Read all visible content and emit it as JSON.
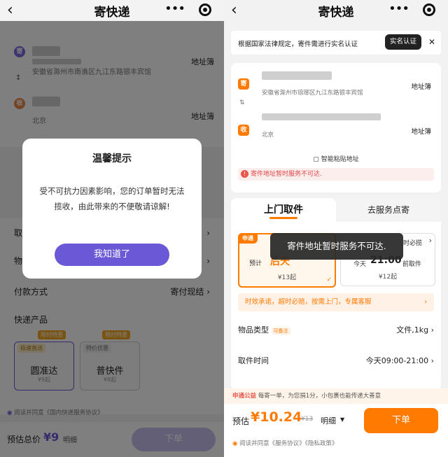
{
  "left": {
    "title": "寄快递",
    "sender_address": "安徽省滁州市南谯区九江东路银丰宾馆",
    "address_book_label": "地址簿",
    "receiver_city": "北京",
    "receiver_address_book_label": "地址簿",
    "payment_label": "付款方式",
    "payment_value": "寄付现结",
    "products_label": "快递产品",
    "products": [
      {
        "tag": "极速直送",
        "badge": "限时特惠",
        "name": "圆准达",
        "price": "¥9起"
      },
      {
        "tag": "特价优惠",
        "badge": "限时特惠",
        "name": "普快件",
        "price": "¥8起"
      }
    ],
    "agreement": "阅读并同意《国内快递服务协议》",
    "estimate_label": "预估总价",
    "estimate_value": "¥9",
    "detail_label": "明细",
    "submit_label": "下单",
    "dialog": {
      "title": "温馨提示",
      "message": "受不可抗力因素影响，您的订单暂时无法揽收，由此带来的不便敬请谅解!",
      "button": "我知道了"
    }
  },
  "right": {
    "title": "寄快递",
    "notice_text": "根据国家法律规定，寄件需进行实名认证",
    "notice_button": "实名认证",
    "sender_tag": "寄",
    "sender_address": "安徽省滁州市琅琊区九江东路银丰宾馆",
    "address_book_label": "地址簿",
    "receiver_tag": "收",
    "receiver_city": "北京",
    "receiver_address_book_label": "地址簿",
    "smart_paste": "智能粘贴地址",
    "warning": "寄件地址暂时服务不可达.",
    "tab_active": "上门取件",
    "tab_other": "去服务点寄",
    "card1_brand": "申通",
    "card1_label": "预计",
    "card1_time": "后天",
    "card1_price": "¥13起",
    "card2_label": "时必揽",
    "card2_time_prefix": "今天",
    "card2_time": "21:00",
    "card2_suffix": "前取件",
    "card2_price": "¥12起",
    "promise": "时效承诺，超时必赔，按需上门，专属客服",
    "item_type_label": "物品类型",
    "item_type_badge": "可备注",
    "item_type_value": "文件,1kg",
    "pickup_time_label": "取件时间",
    "pickup_time_value": "今天09:00-21:00",
    "charity_brand": "申通公益",
    "charity_text": "每寄一单，为您捐1分，小包裹也能传递大善意",
    "estimate_label": "预估",
    "estimate_value": "¥10.24",
    "original_price": "¥13",
    "detail_label": "明细",
    "submit_label": "下单",
    "agreement": "阅读并同意《服务协议》《隐私政策》",
    "toast": "寄件地址暂时服务不可达."
  },
  "colors": {
    "accent_orange": "#ff7a00",
    "dialog_button": "#6b58d6",
    "warning_red": "#e8584b"
  }
}
